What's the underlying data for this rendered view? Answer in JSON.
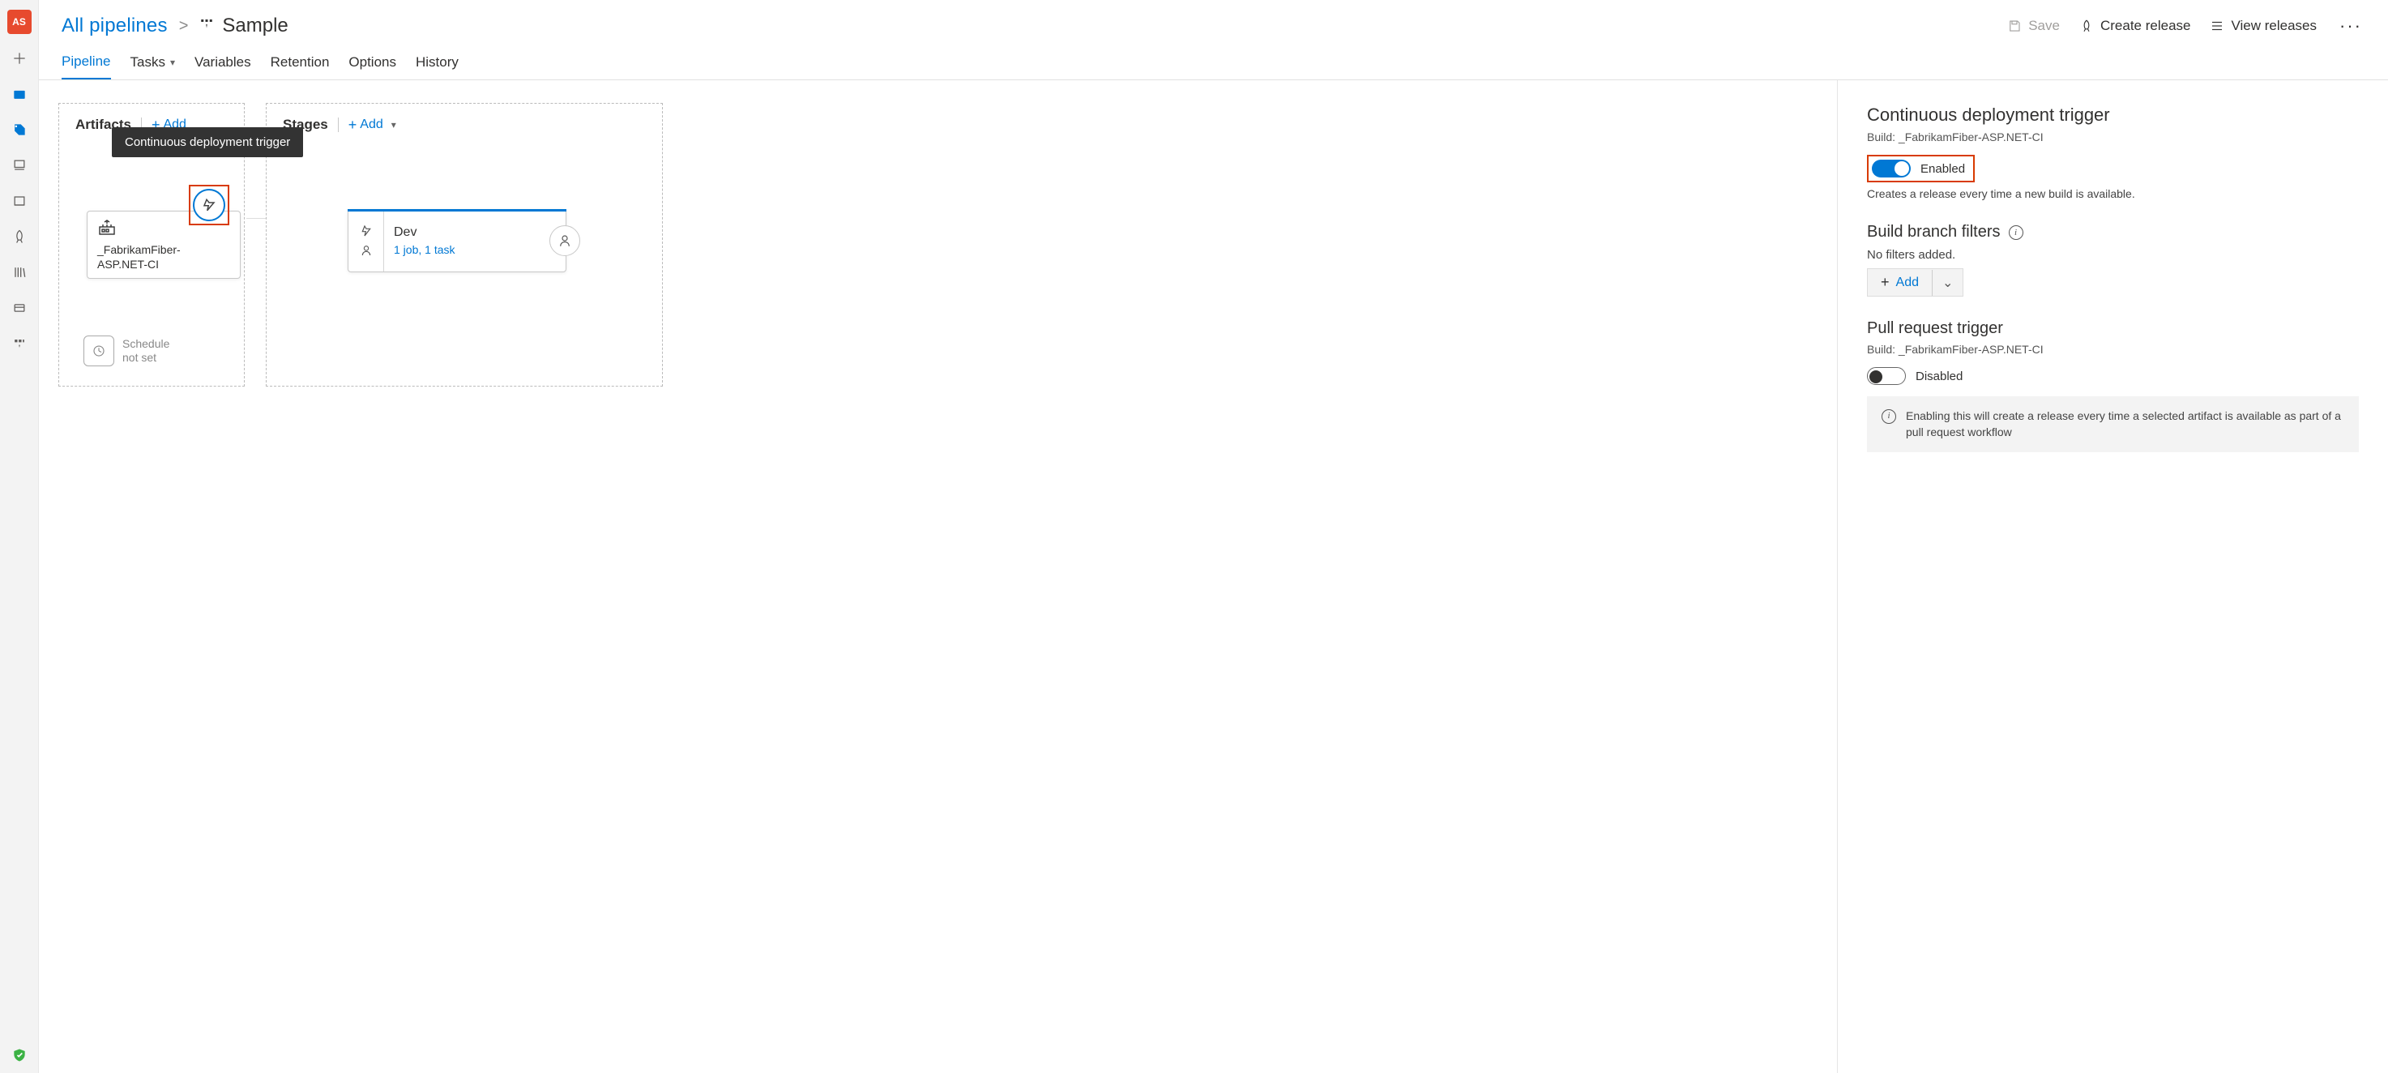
{
  "avatar_initials": "AS",
  "breadcrumb": {
    "parent": "All pipelines",
    "sep": ">",
    "current": "Sample"
  },
  "top_actions": {
    "save": "Save",
    "create_release": "Create release",
    "view_releases": "View releases"
  },
  "tabs": {
    "pipeline": "Pipeline",
    "tasks": "Tasks",
    "variables": "Variables",
    "retention": "Retention",
    "options": "Options",
    "history": "History"
  },
  "panels": {
    "artifacts_title": "Artifacts",
    "stages_title": "Stages",
    "add": "Add",
    "tooltip": "Continuous deployment trigger",
    "artifact_name": "_FabrikamFiber-ASP.NET-CI",
    "schedule_l1": "Schedule",
    "schedule_l2": "not set",
    "stage_name": "Dev",
    "stage_counts": "1 job, 1 task"
  },
  "side": {
    "cd_title": "Continuous deployment trigger",
    "cd_build_prefix": "Build: ",
    "cd_build_name": "_FabrikamFiber-ASP.NET-CI",
    "enabled": "Enabled",
    "cd_desc": "Creates a release every time a new build is available.",
    "branch_title": "Build branch filters",
    "no_filters": "No filters added.",
    "add": "Add",
    "pr_title": "Pull request trigger",
    "pr_build_prefix": "Build: ",
    "pr_build_name": "_FabrikamFiber-ASP.NET-CI",
    "disabled": "Disabled",
    "pr_hint": "Enabling this will create a release every time a selected artifact is available as part of a pull request workflow"
  }
}
